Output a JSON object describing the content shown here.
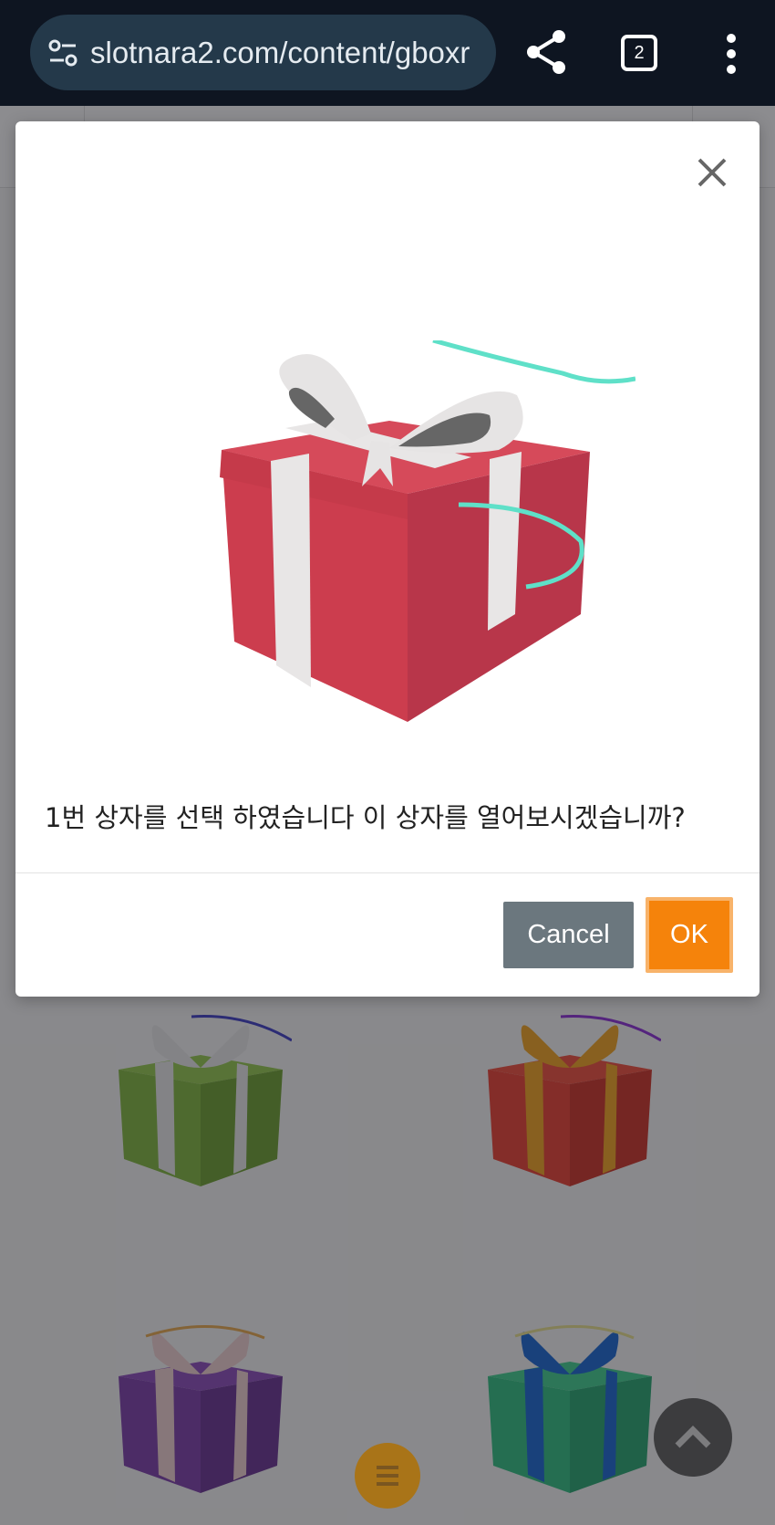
{
  "browser": {
    "url": "slotnara2.com/content/gboxr",
    "tab_count": "2",
    "icons": [
      "tune-icon",
      "share-icon",
      "tab-switcher-icon",
      "more-vert-icon"
    ]
  },
  "dialog": {
    "message": "1번 상자를 선택 하였습니다 이 상자를 열어보시겠습니까?",
    "cancel_label": "Cancel",
    "ok_label": "OK",
    "close_icon": "close-icon"
  },
  "colors": {
    "ok_button": "#f5830b",
    "cancel_button": "#6b777e",
    "chrome_bg": "#0e1521",
    "urlbar_bg": "#24394a"
  },
  "background_gifts": [
    {
      "box": "#7fb63a",
      "ribbon": "#e9e9e9"
    },
    {
      "box": "#ea3d2e",
      "ribbon": "#f2a31d"
    },
    {
      "box": "#7a3aa8",
      "ribbon": "#f0d0d0"
    },
    {
      "box": "#2dbf7f",
      "ribbon": "#1464d2"
    }
  ]
}
